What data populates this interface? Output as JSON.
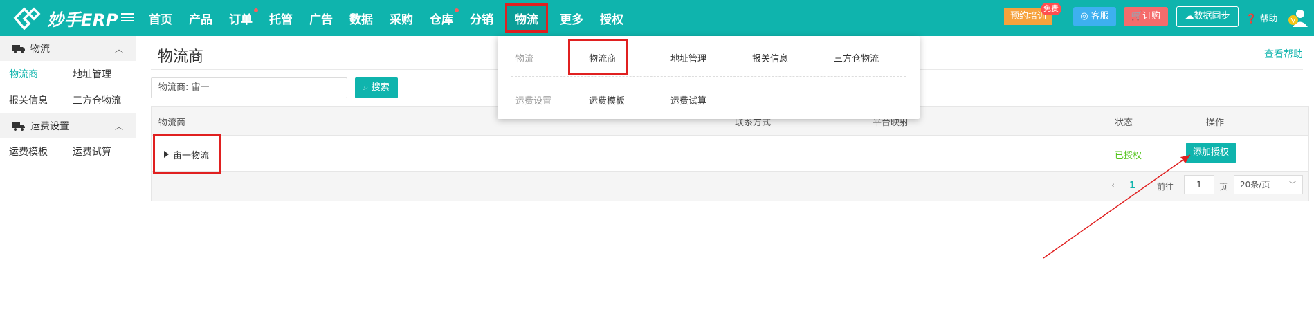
{
  "topbar": {
    "logo_text": "妙手ERP",
    "nav": [
      {
        "label": "首页",
        "dot": false
      },
      {
        "label": "产品",
        "dot": false
      },
      {
        "label": "订单",
        "dot": true
      },
      {
        "label": "托管",
        "dot": false
      },
      {
        "label": "广告",
        "dot": false
      },
      {
        "label": "数据",
        "dot": false
      },
      {
        "label": "采购",
        "dot": false
      },
      {
        "label": "仓库",
        "dot": true
      },
      {
        "label": "分销",
        "dot": false
      },
      {
        "label": "物流",
        "dot": false,
        "active": true
      },
      {
        "label": "更多",
        "dot": false
      },
      {
        "label": "授权",
        "dot": false
      }
    ],
    "train_label": "预约培训",
    "free_badge": "免费",
    "service_label": "客服",
    "order_label": "订购",
    "sync_label": "数据同步",
    "help_label": "帮助",
    "avatar_badge": "V"
  },
  "sidebar": {
    "groups": [
      {
        "title": "物流",
        "items": [
          [
            "物流商",
            "地址管理"
          ],
          [
            "报关信息",
            "三方仓物流"
          ]
        ]
      },
      {
        "title": "运费设置",
        "items": [
          [
            "运费模板",
            "运费试算"
          ]
        ]
      }
    ],
    "active_item": "物流商"
  },
  "main": {
    "title": "物流商",
    "view_help": "查看帮助",
    "search_value": "物流商:  宙一",
    "search_button": "搜索",
    "table": {
      "headers": [
        "物流商",
        "联系方式",
        "平台映射",
        "状态",
        "操作"
      ],
      "rows": [
        {
          "name": "宙一物流",
          "status": "已授权",
          "action": "添加授权"
        }
      ]
    },
    "pager": {
      "current_page": "1",
      "goto_label": "前往",
      "page_input": "1",
      "page_unit": "页",
      "page_size": "20条/页"
    }
  },
  "dropdown": {
    "group1_label": "物流",
    "group1_items": [
      "物流商",
      "地址管理",
      "报关信息",
      "三方仓物流"
    ],
    "group2_label": "运费设置",
    "group2_items": [
      "运费模板",
      "运费试算"
    ]
  },
  "colors": {
    "brand": "#0fb4ad",
    "annotation": "#e02020"
  }
}
